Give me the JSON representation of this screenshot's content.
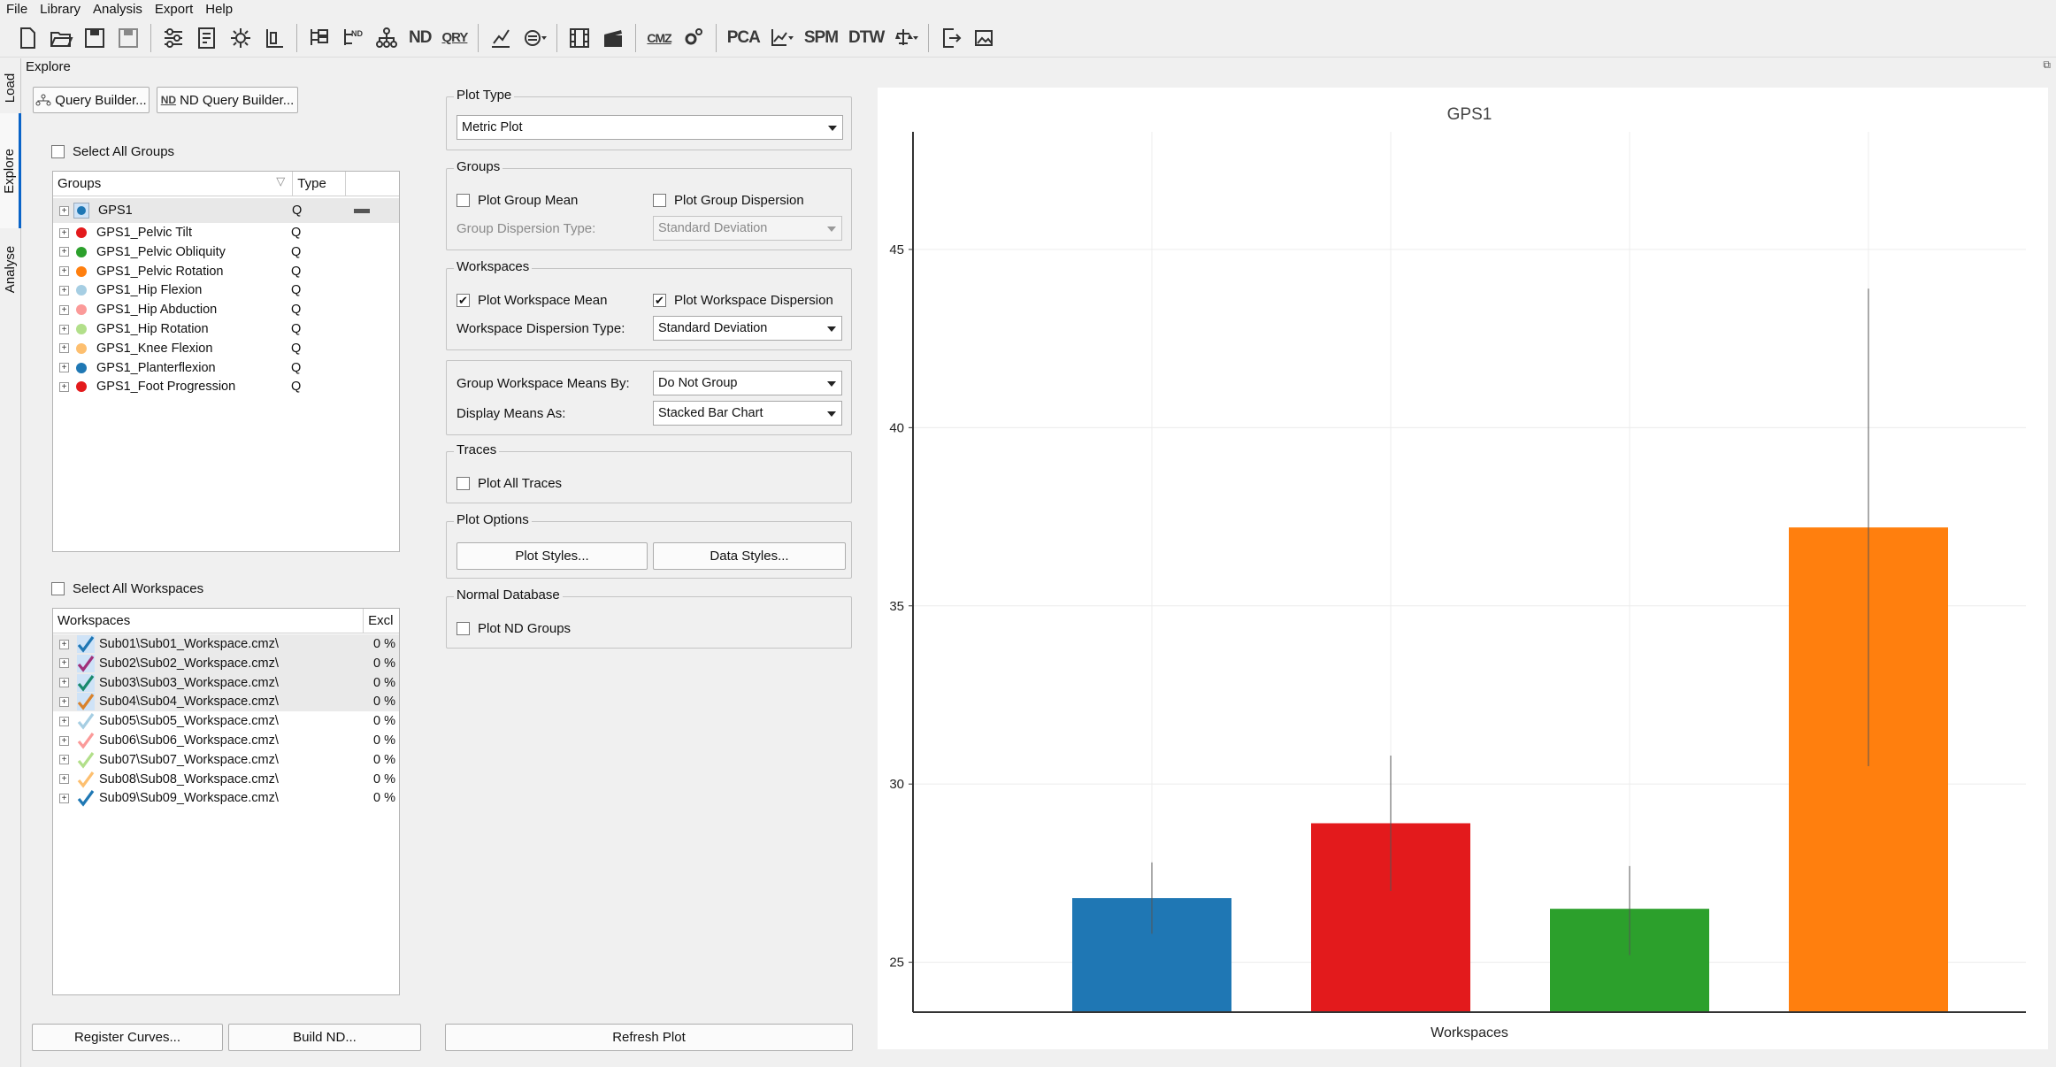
{
  "menu": [
    "File",
    "Library",
    "Analysis",
    "Export",
    "Help"
  ],
  "toolbar": {
    "labels": {
      "nd": "ND",
      "qry": "QRY",
      "cmz": "CMZ",
      "pca": "PCA",
      "spm": "SPM",
      "dtw": "DTW"
    }
  },
  "sidetabs": {
    "load": "Load",
    "explore": "Explore",
    "analyse": "Analyse"
  },
  "explore_title": "Explore",
  "query_builder": "Query Builder...",
  "nd_query_builder": "ND Query Builder...",
  "nd_icon_text": "ND",
  "select_all_groups": "Select All Groups",
  "groups": {
    "col_groups": "Groups",
    "col_type": "Type",
    "rows": [
      {
        "name": "GPS1",
        "type": "Q",
        "color": "#1f77b4"
      },
      {
        "name": "GPS1_Pelvic Tilt",
        "type": "Q",
        "color": "#e31a1c"
      },
      {
        "name": "GPS1_Pelvic Obliquity",
        "type": "Q",
        "color": "#2ca02c"
      },
      {
        "name": "GPS1_Pelvic Rotation",
        "type": "Q",
        "color": "#ff7f0e"
      },
      {
        "name": "GPS1_Hip Flexion",
        "type": "Q",
        "color": "#a6cee3"
      },
      {
        "name": "GPS1_Hip Abduction",
        "type": "Q",
        "color": "#fb9a99"
      },
      {
        "name": "GPS1_Hip Rotation",
        "type": "Q",
        "color": "#b2df8a"
      },
      {
        "name": "GPS1_Knee Flexion",
        "type": "Q",
        "color": "#fdbf6f"
      },
      {
        "name": "GPS1_Planterflexion",
        "type": "Q",
        "color": "#1f78b4"
      },
      {
        "name": "GPS1_Foot Progression",
        "type": "Q",
        "color": "#e31a1c"
      }
    ]
  },
  "select_all_workspaces": "Select All Workspaces",
  "workspaces": {
    "col_workspaces": "Workspaces",
    "col_excl": "Excl",
    "rows": [
      {
        "name": "Sub01\\Sub01_Workspace.cmz\\",
        "excl": "0 %",
        "color": "#1f77b4"
      },
      {
        "name": "Sub02\\Sub02_Workspace.cmz\\",
        "excl": "0 %",
        "color": "#a0307a"
      },
      {
        "name": "Sub03\\Sub03_Workspace.cmz\\",
        "excl": "0 %",
        "color": "#1a8a6e"
      },
      {
        "name": "Sub04\\Sub04_Workspace.cmz\\",
        "excl": "0 %",
        "color": "#d9822b"
      },
      {
        "name": "Sub05\\Sub05_Workspace.cmz\\",
        "excl": "0 %",
        "color": "#a6cee3"
      },
      {
        "name": "Sub06\\Sub06_Workspace.cmz\\",
        "excl": "0 %",
        "color": "#fb9a99"
      },
      {
        "name": "Sub07\\Sub07_Workspace.cmz\\",
        "excl": "0 %",
        "color": "#b2df8a"
      },
      {
        "name": "Sub08\\Sub08_Workspace.cmz\\",
        "excl": "0 %",
        "color": "#fdbf6f"
      },
      {
        "name": "Sub09\\Sub09_Workspace.cmz\\",
        "excl": "0 %",
        "color": "#1f78b4"
      }
    ]
  },
  "register_curves": "Register Curves...",
  "build_nd": "Build ND...",
  "refresh_plot": "Refresh Plot",
  "plot_type": {
    "title": "Plot Type",
    "value": "Metric Plot"
  },
  "groups_box": {
    "title": "Groups",
    "plot_group_mean": "Plot Group Mean",
    "plot_group_dispersion": "Plot Group Dispersion",
    "dispersion_type_label": "Group Dispersion Type:",
    "dispersion_type_value": "Standard Deviation"
  },
  "workspaces_box": {
    "title": "Workspaces",
    "plot_workspace_mean": "Plot Workspace Mean",
    "plot_workspace_dispersion": "Plot Workspace Dispersion",
    "dispersion_type_label": "Workspace Dispersion Type:",
    "dispersion_type_value": "Standard Deviation"
  },
  "means_box": {
    "group_by_label": "Group Workspace Means By:",
    "group_by_value": "Do Not Group",
    "display_as_label": "Display Means As:",
    "display_as_value": "Stacked Bar Chart"
  },
  "traces_box": {
    "title": "Traces",
    "plot_all_traces": "Plot All Traces"
  },
  "plot_options": {
    "title": "Plot Options",
    "plot_styles": "Plot Styles...",
    "data_styles": "Data Styles..."
  },
  "normal_db": {
    "title": "Normal Database",
    "plot_nd_groups": "Plot ND Groups"
  },
  "chart_data": {
    "type": "bar",
    "title": "GPS1",
    "xlabel": "Workspaces",
    "ylabel": "",
    "ylim": [
      23.6,
      48.3
    ],
    "yticks": [
      25,
      30,
      35,
      40,
      45
    ],
    "grid": true,
    "series": [
      {
        "value": 26.8,
        "err_low": 25.8,
        "err_high": 27.8,
        "color": "#1f77b4"
      },
      {
        "value": 28.9,
        "err_low": 27.0,
        "err_high": 30.8,
        "color": "#e31a1c"
      },
      {
        "value": 26.5,
        "err_low": 25.2,
        "err_high": 27.7,
        "color": "#2ca02c"
      },
      {
        "value": 37.2,
        "err_low": 30.5,
        "err_high": 43.9,
        "color": "#ff7f0e"
      }
    ]
  }
}
